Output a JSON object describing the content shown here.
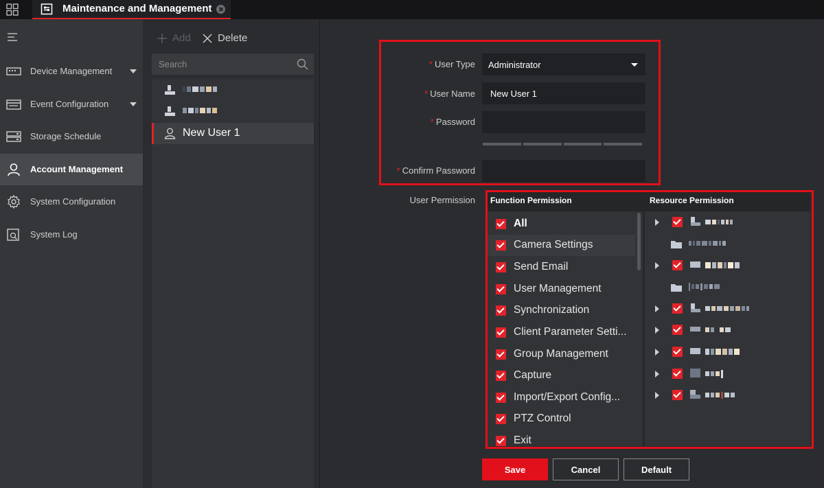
{
  "topbar": {
    "tab_title": "Maintenance and Management"
  },
  "nav": {
    "items": [
      {
        "label": "Device Management",
        "icon": "device-icon",
        "has_caret": true
      },
      {
        "label": "Event Configuration",
        "icon": "event-icon",
        "has_caret": true
      },
      {
        "label": "Storage Schedule",
        "icon": "storage-icon",
        "has_caret": false
      },
      {
        "label": "Account Management",
        "icon": "account-icon",
        "has_caret": false,
        "active": true
      },
      {
        "label": "System Configuration",
        "icon": "gear-icon",
        "has_caret": false
      },
      {
        "label": "System Log",
        "icon": "log-icon",
        "has_caret": false
      }
    ]
  },
  "users": {
    "add_label": "Add",
    "delete_label": "Delete",
    "search_placeholder": "Search",
    "selected_user": "New User 1"
  },
  "form": {
    "user_type_label": "User Type",
    "user_type_value": "Administrator",
    "user_name_label": "User Name",
    "user_name_value": "New User 1",
    "password_label": "Password",
    "confirm_password_label": "Confirm Password",
    "user_permission_label": "User Permission",
    "required_mark": "*"
  },
  "permissions": {
    "function_header": "Function Permission",
    "resource_header": "Resource Permission",
    "function_items": [
      {
        "label": "All",
        "checked": true
      },
      {
        "label": "Camera Settings",
        "checked": true
      },
      {
        "label": "Send Email",
        "checked": true
      },
      {
        "label": "User Management",
        "checked": true
      },
      {
        "label": "Synchronization",
        "checked": true
      },
      {
        "label": "Client Parameter Setti...",
        "checked": true
      },
      {
        "label": "Group Management",
        "checked": true
      },
      {
        "label": "Capture",
        "checked": true
      },
      {
        "label": "Import/Export Config...",
        "checked": true
      },
      {
        "label": "PTZ Control",
        "checked": true
      },
      {
        "label": "Exit",
        "checked": true
      }
    ]
  },
  "buttons": {
    "save": "Save",
    "cancel": "Cancel",
    "default": "Default"
  },
  "colors": {
    "accent": "#e2232a",
    "highlight_box": "#e2101a",
    "background": "#2b2c2f"
  }
}
